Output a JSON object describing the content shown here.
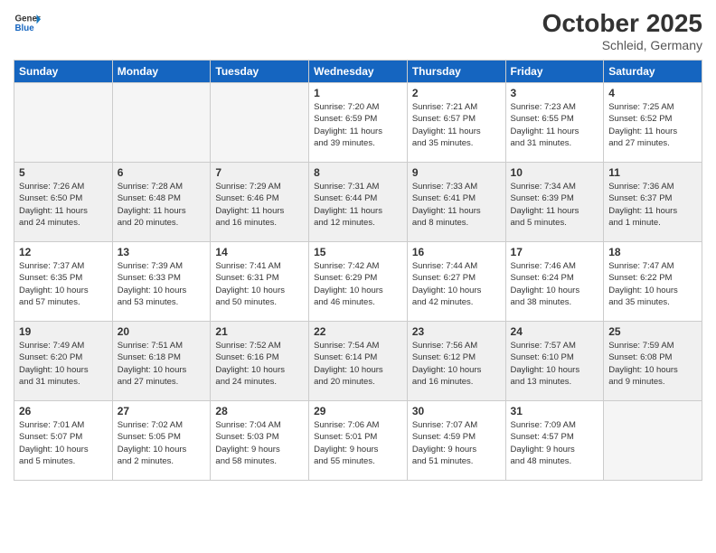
{
  "logo": {
    "line1": "General",
    "line2": "Blue"
  },
  "title": "October 2025",
  "location": "Schleid, Germany",
  "days_of_week": [
    "Sunday",
    "Monday",
    "Tuesday",
    "Wednesday",
    "Thursday",
    "Friday",
    "Saturday"
  ],
  "weeks": [
    [
      {
        "day": "",
        "info": ""
      },
      {
        "day": "",
        "info": ""
      },
      {
        "day": "",
        "info": ""
      },
      {
        "day": "1",
        "info": "Sunrise: 7:20 AM\nSunset: 6:59 PM\nDaylight: 11 hours\nand 39 minutes."
      },
      {
        "day": "2",
        "info": "Sunrise: 7:21 AM\nSunset: 6:57 PM\nDaylight: 11 hours\nand 35 minutes."
      },
      {
        "day": "3",
        "info": "Sunrise: 7:23 AM\nSunset: 6:55 PM\nDaylight: 11 hours\nand 31 minutes."
      },
      {
        "day": "4",
        "info": "Sunrise: 7:25 AM\nSunset: 6:52 PM\nDaylight: 11 hours\nand 27 minutes."
      }
    ],
    [
      {
        "day": "5",
        "info": "Sunrise: 7:26 AM\nSunset: 6:50 PM\nDaylight: 11 hours\nand 24 minutes."
      },
      {
        "day": "6",
        "info": "Sunrise: 7:28 AM\nSunset: 6:48 PM\nDaylight: 11 hours\nand 20 minutes."
      },
      {
        "day": "7",
        "info": "Sunrise: 7:29 AM\nSunset: 6:46 PM\nDaylight: 11 hours\nand 16 minutes."
      },
      {
        "day": "8",
        "info": "Sunrise: 7:31 AM\nSunset: 6:44 PM\nDaylight: 11 hours\nand 12 minutes."
      },
      {
        "day": "9",
        "info": "Sunrise: 7:33 AM\nSunset: 6:41 PM\nDaylight: 11 hours\nand 8 minutes."
      },
      {
        "day": "10",
        "info": "Sunrise: 7:34 AM\nSunset: 6:39 PM\nDaylight: 11 hours\nand 5 minutes."
      },
      {
        "day": "11",
        "info": "Sunrise: 7:36 AM\nSunset: 6:37 PM\nDaylight: 11 hours\nand 1 minute."
      }
    ],
    [
      {
        "day": "12",
        "info": "Sunrise: 7:37 AM\nSunset: 6:35 PM\nDaylight: 10 hours\nand 57 minutes."
      },
      {
        "day": "13",
        "info": "Sunrise: 7:39 AM\nSunset: 6:33 PM\nDaylight: 10 hours\nand 53 minutes."
      },
      {
        "day": "14",
        "info": "Sunrise: 7:41 AM\nSunset: 6:31 PM\nDaylight: 10 hours\nand 50 minutes."
      },
      {
        "day": "15",
        "info": "Sunrise: 7:42 AM\nSunset: 6:29 PM\nDaylight: 10 hours\nand 46 minutes."
      },
      {
        "day": "16",
        "info": "Sunrise: 7:44 AM\nSunset: 6:27 PM\nDaylight: 10 hours\nand 42 minutes."
      },
      {
        "day": "17",
        "info": "Sunrise: 7:46 AM\nSunset: 6:24 PM\nDaylight: 10 hours\nand 38 minutes."
      },
      {
        "day": "18",
        "info": "Sunrise: 7:47 AM\nSunset: 6:22 PM\nDaylight: 10 hours\nand 35 minutes."
      }
    ],
    [
      {
        "day": "19",
        "info": "Sunrise: 7:49 AM\nSunset: 6:20 PM\nDaylight: 10 hours\nand 31 minutes."
      },
      {
        "day": "20",
        "info": "Sunrise: 7:51 AM\nSunset: 6:18 PM\nDaylight: 10 hours\nand 27 minutes."
      },
      {
        "day": "21",
        "info": "Sunrise: 7:52 AM\nSunset: 6:16 PM\nDaylight: 10 hours\nand 24 minutes."
      },
      {
        "day": "22",
        "info": "Sunrise: 7:54 AM\nSunset: 6:14 PM\nDaylight: 10 hours\nand 20 minutes."
      },
      {
        "day": "23",
        "info": "Sunrise: 7:56 AM\nSunset: 6:12 PM\nDaylight: 10 hours\nand 16 minutes."
      },
      {
        "day": "24",
        "info": "Sunrise: 7:57 AM\nSunset: 6:10 PM\nDaylight: 10 hours\nand 13 minutes."
      },
      {
        "day": "25",
        "info": "Sunrise: 7:59 AM\nSunset: 6:08 PM\nDaylight: 10 hours\nand 9 minutes."
      }
    ],
    [
      {
        "day": "26",
        "info": "Sunrise: 7:01 AM\nSunset: 5:07 PM\nDaylight: 10 hours\nand 5 minutes."
      },
      {
        "day": "27",
        "info": "Sunrise: 7:02 AM\nSunset: 5:05 PM\nDaylight: 10 hours\nand 2 minutes."
      },
      {
        "day": "28",
        "info": "Sunrise: 7:04 AM\nSunset: 5:03 PM\nDaylight: 9 hours\nand 58 minutes."
      },
      {
        "day": "29",
        "info": "Sunrise: 7:06 AM\nSunset: 5:01 PM\nDaylight: 9 hours\nand 55 minutes."
      },
      {
        "day": "30",
        "info": "Sunrise: 7:07 AM\nSunset: 4:59 PM\nDaylight: 9 hours\nand 51 minutes."
      },
      {
        "day": "31",
        "info": "Sunrise: 7:09 AM\nSunset: 4:57 PM\nDaylight: 9 hours\nand 48 minutes."
      },
      {
        "day": "",
        "info": ""
      }
    ]
  ]
}
